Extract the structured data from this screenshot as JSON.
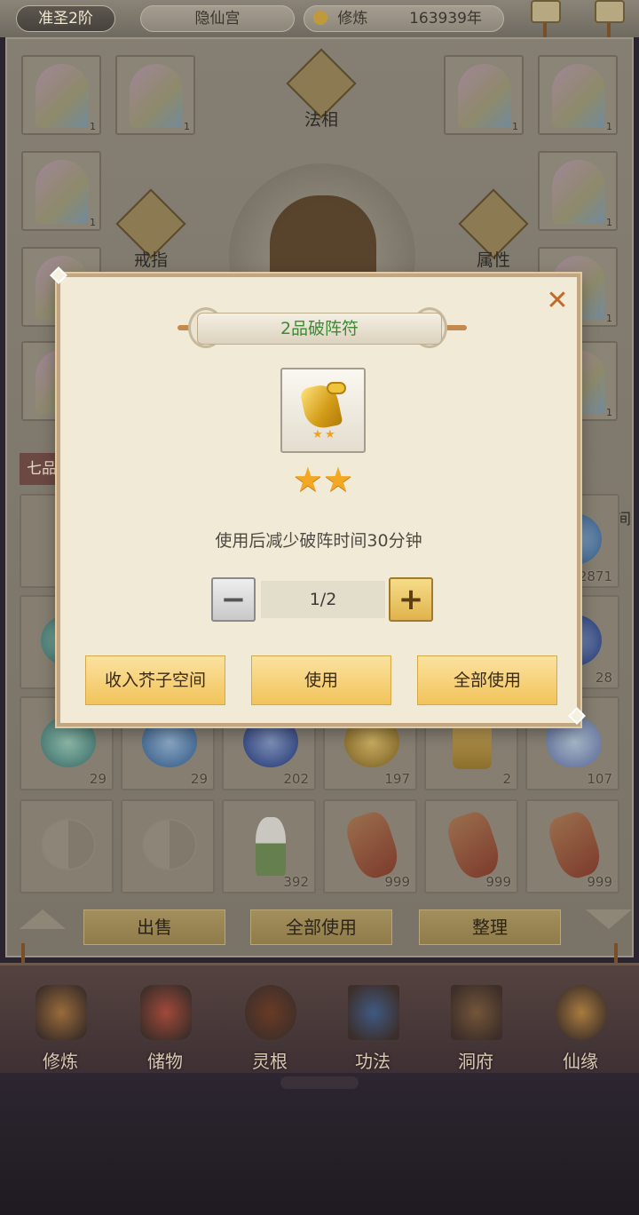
{
  "header": {
    "realm": "准圣2阶",
    "sect": "隐仙宫",
    "cultivation_label": "修炼",
    "cultivation_years": "163939年"
  },
  "equipment": {
    "slot_labels": {
      "dharma": "法相",
      "ring": "戒指",
      "attribute": "属性"
    },
    "slot_count": "1"
  },
  "inventory": {
    "grade_tab": "七品",
    "space_label": "子空间",
    "row1_counts": [
      "",
      "",
      "",
      "",
      "",
      "2871"
    ],
    "row2_counts": [
      "",
      "",
      "",
      "",
      "",
      "28"
    ],
    "row3": [
      {
        "icon": "jade-pouch",
        "count": "29"
      },
      {
        "icon": "sapphire-pouch",
        "count": "29"
      },
      {
        "icon": "navy-pouch",
        "count": "202"
      },
      {
        "icon": "gold-pouch",
        "count": "197"
      },
      {
        "icon": "scroll",
        "count": "2"
      },
      {
        "icon": "fish",
        "count": "107"
      }
    ],
    "row4": [
      {
        "icon": "yinyang",
        "count": ""
      },
      {
        "icon": "yinyang",
        "count": ""
      },
      {
        "icon": "lily",
        "count": "392"
      },
      {
        "icon": "ginseng",
        "count": "999"
      },
      {
        "icon": "ginseng",
        "count": "999"
      },
      {
        "icon": "ginseng",
        "count": "999"
      }
    ],
    "buttons": {
      "sell": "出售",
      "use_all": "全部使用",
      "sort": "整理"
    }
  },
  "nav": [
    {
      "key": "cultivate",
      "label": "修炼",
      "color": "#a7743a"
    },
    {
      "key": "storage",
      "label": "储物",
      "color": "#b04c3a"
    },
    {
      "key": "spirit-root",
      "label": "灵根",
      "color": "#6e3a22"
    },
    {
      "key": "techniques",
      "label": "功法",
      "color": "#3d5f8f"
    },
    {
      "key": "cave",
      "label": "洞府",
      "color": "#7b5a3a"
    },
    {
      "key": "fate",
      "label": "仙缘",
      "color": "#b9873f"
    }
  ],
  "modal": {
    "title": "2品破阵符",
    "close_glyph": "✕",
    "star_count": 2,
    "star_glyph": "★",
    "description": "使用后减少破阵时间30分钟",
    "quantity": "1/2",
    "minus_glyph": "−",
    "plus_glyph": "+",
    "buttons": {
      "store": "收入芥子空间",
      "use": "使用",
      "use_all": "全部使用"
    }
  }
}
